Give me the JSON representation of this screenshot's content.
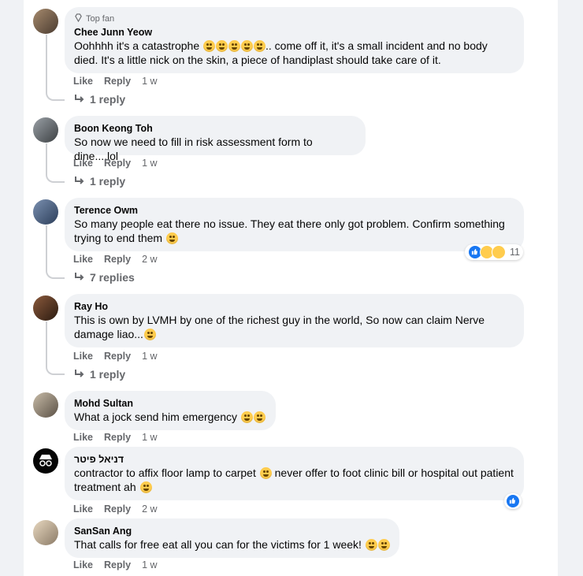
{
  "comments": [
    {
      "badge": "Top fan",
      "author": "Chee Junn Yeow",
      "text_a": "Oohhhh it's a catastrophe",
      "text_b": ".. come off it, it's a small incident and no body died. It's a little nick on the skin, a piece of handiplast should take care of it.",
      "like": "Like",
      "reply": "Reply",
      "time": "1 w",
      "replies": "1 reply"
    },
    {
      "author": "Boon Keong Toh",
      "text": "So now we need to fill in risk assessment form to dine....lol",
      "like": "Like",
      "reply": "Reply",
      "time": "1 w",
      "replies": "1 reply"
    },
    {
      "author": "Terence Owm",
      "text": "So many people eat there no issue. They eat there only got problem. Confirm something trying to end them",
      "like": "Like",
      "reply": "Reply",
      "time": "2 w",
      "reaction_count": "11",
      "replies": "7 replies"
    },
    {
      "author": "Ray Ho",
      "text": "This is own by LVMH by one of the richest guy in the world, So now can claim Nerve damage liao...",
      "like": "Like",
      "reply": "Reply",
      "time": "1 w",
      "replies": "1 reply"
    },
    {
      "author": "Mohd Sultan",
      "text": "What a jock send him emergency",
      "like": "Like",
      "reply": "Reply",
      "time": "1 w"
    },
    {
      "author": "דניאל פיטר",
      "text_a": "contractor to affix floor lamp to carpet",
      "text_b": "never offer to foot clinic bill or hospital out patient treatment ah",
      "like": "Like",
      "reply": "Reply",
      "time": "2 w"
    },
    {
      "author": "SanSan Ang",
      "text": "That calls for free eat all you can for the victims for 1 week!",
      "like": "Like",
      "reply": "Reply",
      "time": "1 w"
    }
  ],
  "colors": {
    "accent": "#1877f2",
    "bubble": "#f0f2f5",
    "muted": "#65676b"
  },
  "icons": [
    "diamond-icon",
    "reply-arrow-icon",
    "like-reaction-icon",
    "haha-reaction-icon",
    "wow-reaction-icon",
    "emoji-icon"
  ]
}
